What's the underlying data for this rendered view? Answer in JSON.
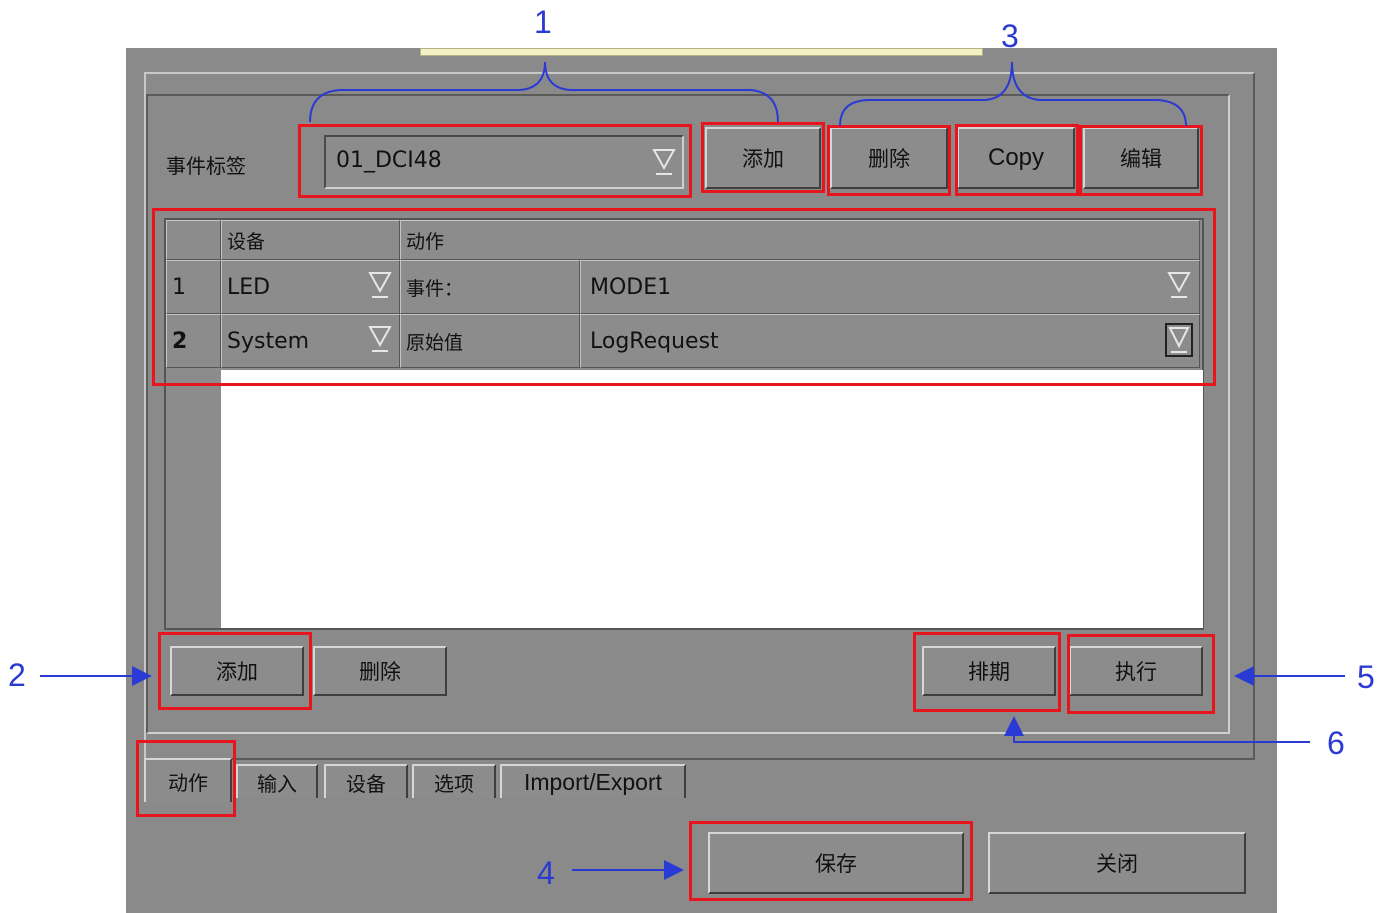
{
  "event": {
    "label": "事件标签",
    "tag_value": "01_DCI48",
    "add_label": "添加",
    "delete_label": "删除",
    "copy_label": "Copy",
    "edit_label": "编辑"
  },
  "grid": {
    "headers": [
      "设备",
      "动作"
    ],
    "rows": [
      {
        "index": "1",
        "device": "LED",
        "action": "事件：",
        "value": "MODE1"
      },
      {
        "index": "2",
        "device": "System",
        "action": "原始值",
        "value": "LogRequest"
      }
    ]
  },
  "actions": {
    "add_label": "添加",
    "delete_label": "删除",
    "schedule_label": "排期",
    "execute_label": "执行"
  },
  "tabs": [
    "动作",
    "输入",
    "设备",
    "选项",
    "Import/Export"
  ],
  "footer": {
    "save_label": "保存",
    "close_label": "关闭"
  },
  "callouts": [
    "1",
    "2",
    "3",
    "4",
    "5",
    "6"
  ],
  "colors": {
    "highlight": "#e8161c",
    "callout": "#2b3ad4",
    "panel": "#8a8a8a"
  }
}
